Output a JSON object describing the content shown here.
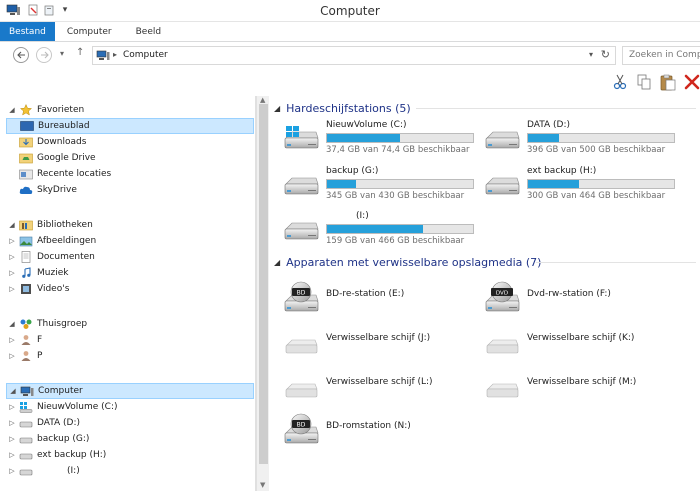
{
  "window": {
    "title": "Computer"
  },
  "ribbon": {
    "tabs": [
      "Bestand",
      "Computer",
      "Beeld"
    ]
  },
  "address": {
    "path": "Computer",
    "search_placeholder": "Zoeken in Comp"
  },
  "nav": {
    "favorites_header": "Favorieten",
    "favorites": [
      "Bureaublad",
      "Downloads",
      "Google Drive",
      "Recente locaties",
      "SkyDrive"
    ],
    "libraries_header": "Bibliotheken",
    "libraries": [
      "Afbeeldingen",
      "Documenten",
      "Muziek",
      "Video's"
    ],
    "homegroup_header": "Thuisgroep",
    "homegroup": [
      "F",
      "P"
    ],
    "computer_header": "Computer",
    "computer": [
      "NieuwVolume (C:)",
      "DATA (D:)",
      "backup (G:)",
      "ext backup (H:)",
      "(I:)"
    ]
  },
  "content": {
    "hdd_header": "Hardeschijfstations (5)",
    "drives": [
      {
        "name": "NieuwVolume (C:)",
        "sub": "37,4 GB van 74,4 GB beschikbaar",
        "used": 0.5
      },
      {
        "name": "DATA (D:)",
        "sub": "396 GB van 500 GB beschikbaar",
        "used": 0.21
      },
      {
        "name": "backup (G:)",
        "sub": "345 GB van 430 GB beschikbaar",
        "used": 0.2
      },
      {
        "name": "ext backup (H:)",
        "sub": "300 GB van 464 GB beschikbaar",
        "used": 0.35
      },
      {
        "name": "(I:)",
        "sub": "159 GB van 466 GB beschikbaar",
        "used": 0.66
      }
    ],
    "removable_header": "Apparaten met verwisselbare opslagmedia (7)",
    "devices": [
      {
        "name": "BD-re-station (E:)",
        "label": "BD"
      },
      {
        "name": "Dvd-rw-station (F:)",
        "label": "DVD"
      },
      {
        "name": "Verwisselbare schijf (J:)"
      },
      {
        "name": "Verwisselbare schijf (K:)"
      },
      {
        "name": "Verwisselbare schijf (L:)"
      },
      {
        "name": "Verwisselbare schijf (M:)"
      },
      {
        "name": "BD-romstation (N:)",
        "label": "BD"
      }
    ]
  },
  "colors": {
    "accent": "#1979ca",
    "bar": "#26a0da",
    "group": "#1e3287",
    "selection": "#cce8ff"
  }
}
